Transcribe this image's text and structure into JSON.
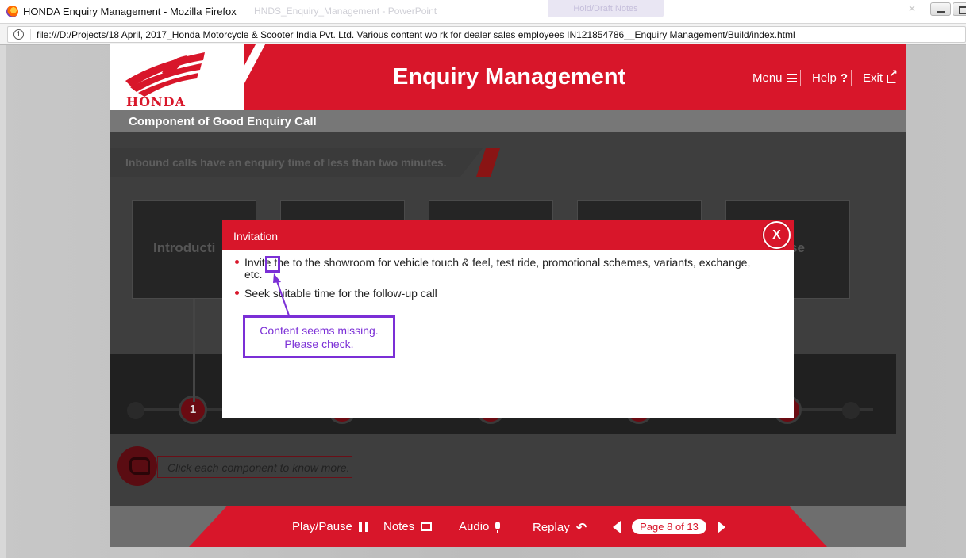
{
  "browser": {
    "window_title": "HONDA Enquiry Management - Mozilla Firefox",
    "ghost_tab": "HNDS_Enquiry_Management - PowerPoint",
    "ghost_tab2": "Hold/Draft Notes",
    "url": "file:///D:/Projects/18 April, 2017_Honda Motorcycle & Scooter India Pvt. Ltd. Various content wo rk for dealer sales employees IN121854786__Enquiry Management/Build/index.html"
  },
  "header": {
    "brand": "HONDA",
    "title": "Enquiry Management",
    "menu_label": "Menu",
    "help_label": "Help",
    "help_icon_text": "?",
    "exit_label": "Exit"
  },
  "subtitle": "Component of Good Enquiry Call",
  "content": {
    "intro_text": "Inbound calls have an enquiry time of less than two minutes.",
    "cards": [
      "Introducti",
      "",
      "",
      "",
      "se"
    ],
    "timeline_first_node": "1",
    "hint": "Click each component to know more."
  },
  "popup": {
    "title": "Invitation",
    "close_label": "X",
    "bullets": [
      "Invite the to the showroom for vehicle touch & feel, test ride, promotional schemes, variants, exchange, etc.",
      "Seek suitable time for the follow-up call"
    ]
  },
  "annotation": {
    "text_line1": "Content seems missing.",
    "text_line2": "Please check."
  },
  "footer": {
    "play_pause": "Play/Pause",
    "notes": "Notes",
    "audio": "Audio",
    "replay": "Replay",
    "page_indicator": "Page 8 of 13"
  },
  "colors": {
    "brand_red": "#d8162a",
    "annotation_purple": "#7b2fd6"
  }
}
